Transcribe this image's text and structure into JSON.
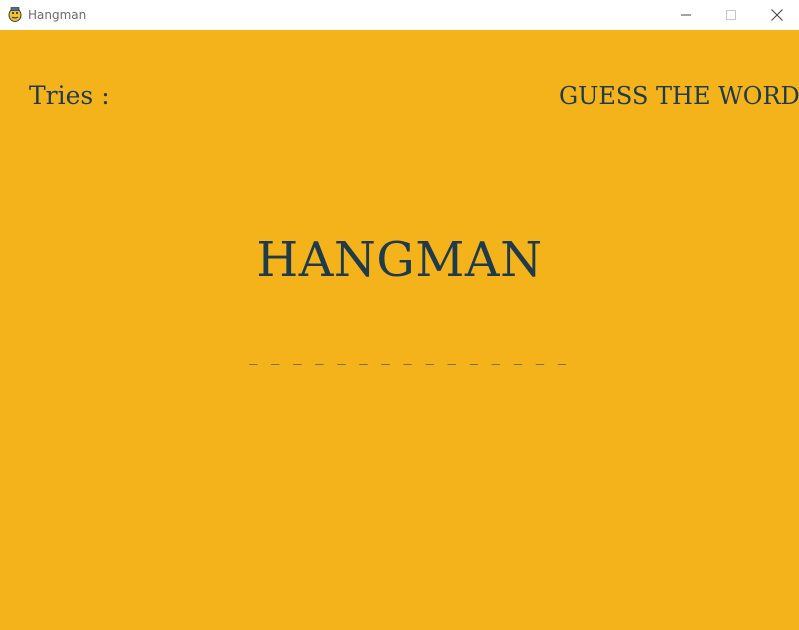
{
  "window": {
    "title": "Hangman",
    "app_icon": "pygame-snake-icon",
    "controls": {
      "minimize_icon": "minimize-icon",
      "maximize_icon": "maximize-icon",
      "close_icon": "close-icon"
    }
  },
  "game": {
    "background_color": "#f4b31a",
    "text_color": "#1f3a4a",
    "tries_label": "Tries :",
    "prompt": "GUESS THE WORD",
    "heading": "HANGMAN",
    "word_blanks": "_ _ _ _ _ _ _ _ _ _ _ _ _ _ _"
  }
}
